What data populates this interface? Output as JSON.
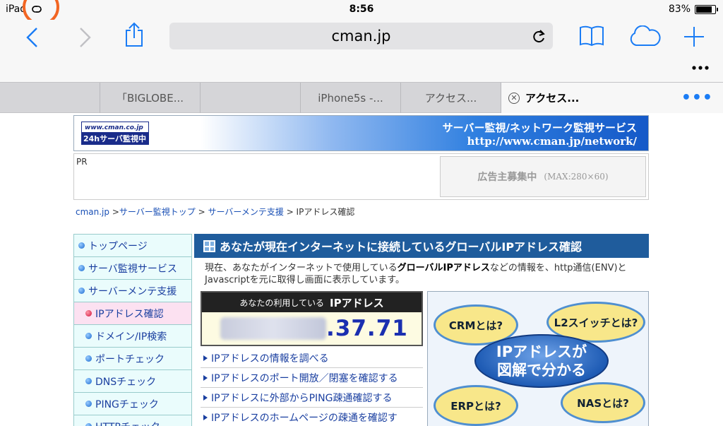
{
  "status": {
    "device": "iPad",
    "time": "8:56",
    "battery": "83%",
    "battery_level": 0.83
  },
  "toolbar": {
    "url": "cman.jp"
  },
  "tabs": [
    {
      "label": ""
    },
    {
      "label": "「BIGLOBE..."
    },
    {
      "label": ""
    },
    {
      "label": "iPhone5s -..."
    },
    {
      "label": "アクセス...",
      "active": true
    }
  ],
  "page": {
    "banner": {
      "logo_line1": "www.cman.co.jp",
      "logo_line2": "24hサーバ監視中",
      "title": "サーバー監視/ネットワーク監視サービス",
      "url": "http://www.cman.jp/network/"
    },
    "pr": {
      "label": "PR",
      "ad_text": "広告主募集中",
      "ad_size": "(MAX:280×60)"
    },
    "breadcrumb": [
      {
        "label": "cman.jp",
        "link": true
      },
      {
        "label": " >",
        "link": false
      },
      {
        "label": "サーバー監視トップ",
        "link": true
      },
      {
        "label": " > ",
        "link": false
      },
      {
        "label": "サーバーメンテ支援",
        "link": true
      },
      {
        "label": " > IPアドレス確認",
        "link": false
      }
    ],
    "sidebar": [
      {
        "label": "トップページ",
        "sub": false
      },
      {
        "label": "サーバ監視サービス",
        "sub": false
      },
      {
        "label": "サーバーメンテ支援",
        "sub": false
      },
      {
        "label": "IPアドレス確認",
        "sub": true,
        "active": true
      },
      {
        "label": "ドメイン/IP検索",
        "sub": true
      },
      {
        "label": "ポートチェック",
        "sub": true
      },
      {
        "label": "DNSチェック",
        "sub": true
      },
      {
        "label": "PINGチェック",
        "sub": true
      },
      {
        "label": "HTTPチェック",
        "sub": true
      }
    ],
    "main": {
      "title": "あなたが現在インターネットに接続しているグローバルIPアドレス確認",
      "desc_part1": "現在、あなたがインターネットで使用している",
      "desc_bold": "グローバルIPアドレス",
      "desc_part2": "などの情報を、http通信(ENV)とJavascriptを元に取得し画面に表示しています。",
      "ip_head_small": "あなたの利用している",
      "ip_head_big": "IPアドレス",
      "ip_visible": ".37.71",
      "links": [
        "IPアドレスの情報を調べる",
        "IPアドレスのポート開放／閉塞を確認する",
        "IPアドレスに外部からPING疎通確認する",
        "IPアドレスのホームページの疎通を確認す"
      ],
      "ad": {
        "b1": "CRMとは?",
        "b2": "L2スイッチとは?",
        "b3": "ERPとは?",
        "b4": "NASとは?",
        "center1": "IPアドレスが",
        "center2": "図解で分かる"
      }
    }
  }
}
